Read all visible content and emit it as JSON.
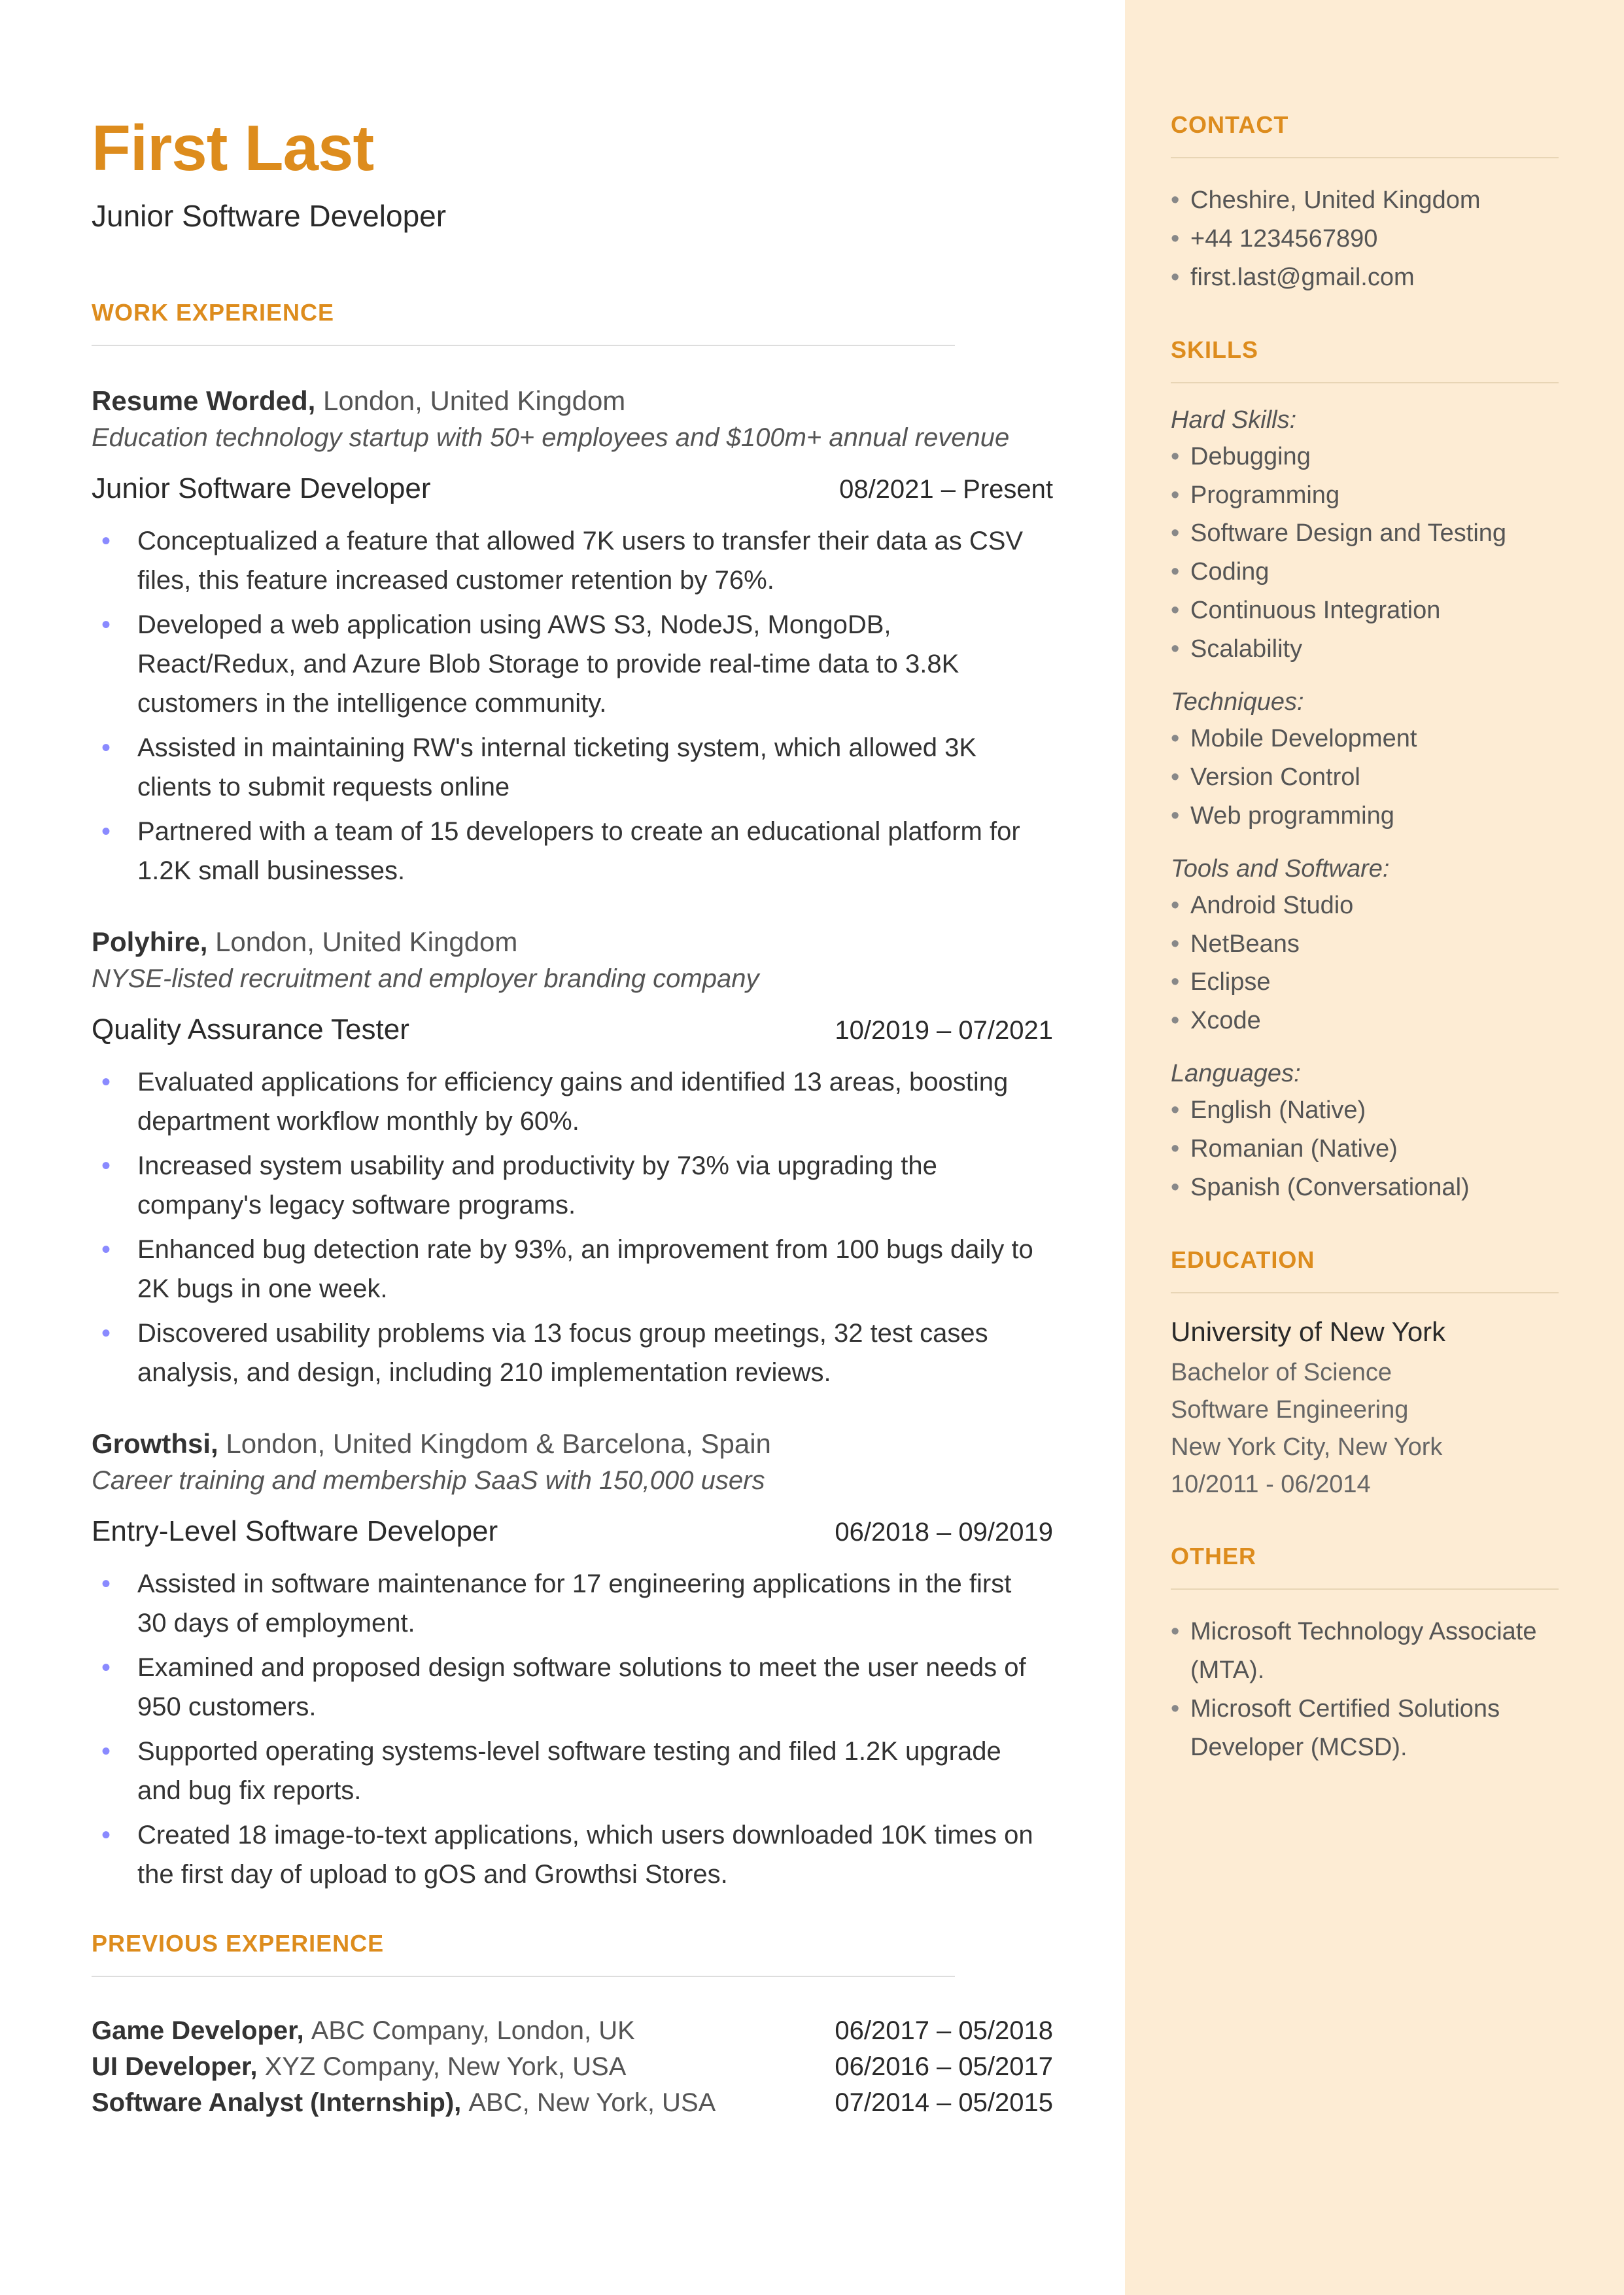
{
  "name": "First Last",
  "title": "Junior Software Developer",
  "sections": {
    "work": "WORK EXPERIENCE",
    "previous": "PREVIOUS EXPERIENCE",
    "contact": "CONTACT",
    "skills": "SKILLS",
    "education": "EDUCATION",
    "other": "OTHER"
  },
  "jobs": [
    {
      "company": "Resume Worded,",
      "location": "London, United Kingdom",
      "desc": "Education technology startup with 50+ employees and $100m+ annual revenue",
      "role": "Junior Software Developer",
      "dates": "08/2021 – Present",
      "bullets": [
        "Conceptualized a feature that allowed 7K users to transfer their data as CSV files, this feature increased customer retention by 76%.",
        "Developed a web application using AWS S3, NodeJS, MongoDB, React/Redux, and Azure Blob Storage to provide real-time data to 3.8K customers in the intelligence community.",
        "Assisted in maintaining RW's internal ticketing system, which allowed 3K clients to submit requests online",
        "Partnered with a team of 15 developers to create an educational platform for 1.2K small businesses."
      ]
    },
    {
      "company": "Polyhire,",
      "location": "London, United Kingdom",
      "desc": "NYSE-listed recruitment and employer branding company",
      "role": "Quality Assurance Tester",
      "dates": "10/2019 – 07/2021",
      "bullets": [
        "Evaluated applications for efficiency gains and identified 13 areas, boosting department workflow monthly by 60%.",
        "Increased system usability and productivity by 73% via upgrading the company's legacy software programs.",
        "Enhanced bug detection rate by 93%, an improvement from 100 bugs daily to 2K bugs in one week.",
        "Discovered usability problems via 13 focus group meetings, 32 test cases analysis, and design, including 210 implementation reviews."
      ]
    },
    {
      "company": "Growthsi,",
      "location": "London, United Kingdom & Barcelona, Spain",
      "desc": "Career training and membership SaaS with 150,000 users",
      "role": "Entry-Level Software Developer",
      "dates": "06/2018 – 09/2019",
      "bullets": [
        "Assisted in software maintenance for 17 engineering applications in the first 30 days of employment.",
        "Examined and proposed design software solutions to meet the user needs of 950 customers.",
        "Supported operating systems-level software testing and filed 1.2K upgrade and bug fix reports.",
        "Created 18 image-to-text applications, which users downloaded 10K times on the first day of upload to gOS and Growthsi Stores."
      ]
    }
  ],
  "previous": [
    {
      "role": "Game Developer,",
      "company": "ABC Company, London, UK",
      "dates": "06/2017 – 05/2018"
    },
    {
      "role": "UI Developer,",
      "company": "XYZ Company, New York, USA",
      "dates": "06/2016 – 05/2017"
    },
    {
      "role": "Software Analyst (Internship),",
      "company": "ABC, New York, USA",
      "dates": "07/2014 – 05/2015"
    }
  ],
  "contact": [
    "Cheshire, United Kingdom",
    "+44 1234567890",
    "first.last@gmail.com"
  ],
  "skills": {
    "hard_label": "Hard Skills:",
    "hard": [
      "Debugging",
      "Programming",
      "Software Design and Testing",
      "Coding",
      "Continuous Integration",
      "Scalability"
    ],
    "tech_label": "Techniques:",
    "tech": [
      "Mobile Development",
      "Version Control",
      "Web programming"
    ],
    "tools_label": "Tools and Software:",
    "tools": [
      "Android Studio",
      "NetBeans",
      "Eclipse",
      "Xcode"
    ],
    "lang_label": "Languages:",
    "lang": [
      "English (Native)",
      "Romanian (Native)",
      "Spanish (Conversational)"
    ]
  },
  "education": {
    "school": "University of New York",
    "degree": "Bachelor of Science",
    "field": "Software Engineering",
    "loc": "New York City, New York",
    "dates": "10/2011 - 06/2014"
  },
  "other": [
    "Microsoft Technology Associate (MTA).",
    "Microsoft Certified Solutions Developer (MCSD)."
  ]
}
